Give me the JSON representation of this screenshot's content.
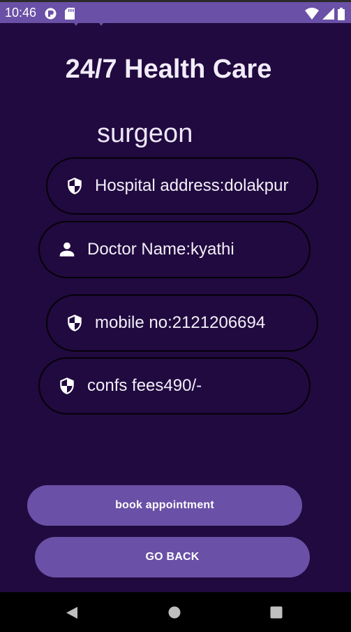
{
  "status_bar": {
    "time": "10:46",
    "icons": [
      "app-notification-icon",
      "sd-card-icon",
      "wifi-icon",
      "signal-icon",
      "battery-icon"
    ]
  },
  "app": {
    "title": "24/7 Health Care",
    "specialty": "surgeon"
  },
  "details": [
    {
      "icon": "shield-icon",
      "text": "Hospital address:dolakpur"
    },
    {
      "icon": "person-icon",
      "text": "Doctor Name:kyathi"
    },
    {
      "icon": "shield-icon",
      "text": "mobile no:2121206694"
    },
    {
      "icon": "shield-icon",
      "text": "confs fees490/-"
    }
  ],
  "buttons": {
    "book": "book appointment",
    "back": "GO BACK"
  },
  "colors": {
    "background": "#210a3f",
    "accent": "#6a50a6",
    "text": "#ffffff"
  },
  "navigation": [
    "back-icon",
    "home-icon",
    "recents-icon"
  ]
}
